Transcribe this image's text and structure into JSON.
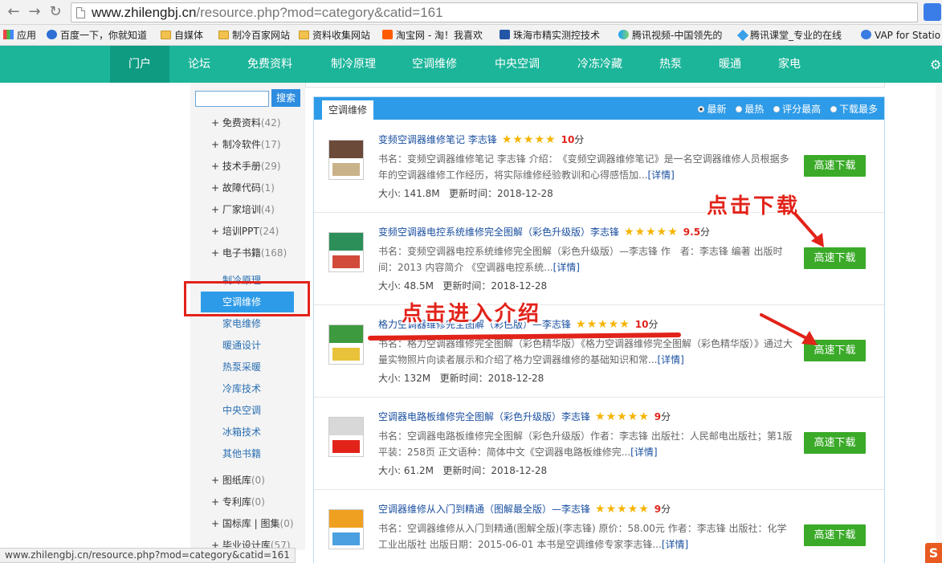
{
  "browser": {
    "url_host": "www.zhilengbj.cn",
    "url_path": "/resource.php?mod=category&catid=161",
    "status_url": "www.zhilengbj.cn/resource.php?mod=category&catid=161",
    "bookmarks": [
      {
        "label": "应用",
        "icon": "apps-grid-icon"
      },
      {
        "label": "百度一下，你就知道",
        "icon": "baidu-paw-icon"
      },
      {
        "label": "自媒体",
        "icon": "folder-icon"
      },
      {
        "label": "制冷百家网站",
        "icon": "folder-icon"
      },
      {
        "label": "资料收集网站",
        "icon": "folder-icon"
      },
      {
        "label": "淘宝网 - 淘！我喜欢",
        "icon": "taobao-icon"
      },
      {
        "label": "珠海市精实测控技术",
        "icon": "check-logo-icon"
      },
      {
        "label": "腾讯视频-中国领先的",
        "icon": "tencent-video-icon"
      },
      {
        "label": "腾讯课堂_专业的在线",
        "icon": "tencent-class-icon"
      },
      {
        "label": "VAP for Statio",
        "icon": "snowflake-icon"
      }
    ]
  },
  "site_nav": {
    "items": [
      "门户",
      "论坛",
      "免费资料",
      "制冷原理",
      "空调维修",
      "中央空调",
      "冷冻冷藏",
      "热泵",
      "暖通",
      "家电"
    ],
    "active": "门户"
  },
  "sidebar": {
    "search_button": "搜索",
    "categories": [
      {
        "label": "+ 免费资料",
        "count": "(42)"
      },
      {
        "label": "+ 制冷软件",
        "count": "(17)"
      },
      {
        "label": "+ 技术手册",
        "count": "(29)"
      },
      {
        "label": "+ 故障代码",
        "count": "(1)"
      },
      {
        "label": "+ 厂家培训",
        "count": "(4)"
      },
      {
        "label": "+ 培训PPT",
        "count": "(24)"
      },
      {
        "label": "+ 电子书籍",
        "count": "(168)"
      }
    ],
    "subcategories": [
      "制冷原理",
      "空调维修",
      "家电维修",
      "暖通设计",
      "热泵采暖",
      "冷库技术",
      "中央空调",
      "冰箱技术",
      "其他书籍"
    ],
    "active_sub": "空调维修",
    "more_categories": [
      {
        "label": "+ 图纸库",
        "count": "(0)"
      },
      {
        "label": "+ 专利库",
        "count": "(0)"
      },
      {
        "label": "+ 国标库 | 图集",
        "count": "(0)"
      },
      {
        "label": "+ 毕业设计库",
        "count": "(57)"
      }
    ]
  },
  "panel": {
    "tab": "空调维修",
    "sorts": [
      {
        "label": "最新",
        "selected": true
      },
      {
        "label": "最热",
        "selected": false
      },
      {
        "label": "评分最高",
        "selected": false
      },
      {
        "label": "下载最多",
        "selected": false
      }
    ],
    "download_label": "高速下载",
    "more_label": "[详情]",
    "score_unit": "分",
    "items": [
      {
        "title": "变频空调器维修笔记 李志锋",
        "stars": "★★★★★",
        "score": "10",
        "desc": "书名：变频空调器维修笔记 李志锋 介绍：　《变频空调器维修笔记》是一名空调器维修人员根据多年的空调器维修工作经历，将实际维修经验教训和心得感悟加...",
        "size": "大小: 141.8M",
        "updated": "更新时间：2018-12-28",
        "thumb_colors": [
          "#6b4a3a",
          "#c9b28a"
        ]
      },
      {
        "title": "变频空调器电控系统维修完全图解（彩色升级版）李志锋",
        "stars": "★★★★★",
        "score": "9.5",
        "desc": "书名：变频空调器电控系统维修完全图解（彩色升级版）—李志锋 作　者：李志锋 编著 出版时间：2013 内容简介 《空调器电控系统...",
        "size": "大小: 48.5M",
        "updated": "更新时间：2018-12-28",
        "thumb_colors": [
          "#2c8f5a",
          "#d24a3a"
        ]
      },
      {
        "title": "格力空调器维修完全图解（彩色版）—李志锋",
        "stars": "★★★★★",
        "score": "10",
        "desc": "书名：格力空调器维修完全图解（彩色精华版）《格力空调器维修完全图解（彩色精华版）》通过大量实物照片向读者展示和介绍了格力空调器维修的基础知识和常...",
        "size": "大小: 132M",
        "updated": "更新时间：2018-12-28",
        "thumb_colors": [
          "#3e9a3e",
          "#e8c23a"
        ]
      },
      {
        "title": "空调器电路板维修完全图解（彩色升级版）李志锋",
        "stars": "★★★★★",
        "score": "9",
        "desc": "书名：空调器电路板维修完全图解（彩色升级版）作者：李志锋 出版社：人民邮电出版社；第1版 平装：258页 正文语种：简体中文《空调器电路板维修完...",
        "size": "大小: 61.2M",
        "updated": "更新时间：2018-12-28",
        "thumb_colors": [
          "#d8d8d8",
          "#e2231a"
        ]
      },
      {
        "title": "空调器维修从入门到精通（图解最全版）—李志锋",
        "stars": "★★★★★",
        "score": "9",
        "desc": "书名：空调器维修从入门到精通(图解全版)(李志锋) 原价：58.00元 作者：李志锋 出版社：化学工业出版社 出版日期：2015-06-01 本书是空调维修专家李志锋...",
        "size": "",
        "updated": "",
        "thumb_colors": [
          "#f0a020",
          "#4aa0e0"
        ]
      }
    ]
  },
  "annotations": {
    "click_download": "点击下载",
    "click_intro": "点击进入介绍"
  },
  "colors": {
    "nav_green": "#1cb59a",
    "panel_blue": "#2e9be8",
    "download_green": "#3aaa28",
    "annotation_red": "#e2231a",
    "star_gold": "#f6b400"
  }
}
